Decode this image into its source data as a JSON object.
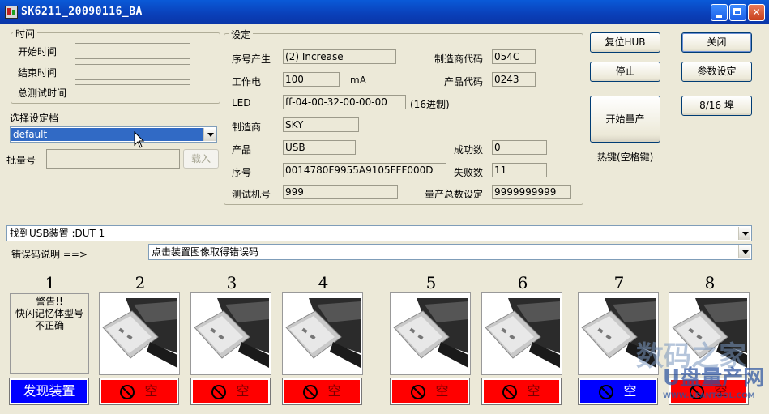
{
  "window": {
    "title": "SK6211_20090116_BA"
  },
  "time_group": {
    "legend": "时间",
    "start_label": "开始时间",
    "end_label": "结束时间",
    "total_label": "总测试时间",
    "start_value": "",
    "end_value": "",
    "total_value": ""
  },
  "profile": {
    "label": "选择设定档",
    "selected": "default"
  },
  "batch": {
    "label": "批量号",
    "value": "",
    "load_button": "载入"
  },
  "settings": {
    "legend": "设定",
    "serial_gen_label": "序号产生",
    "serial_gen_value": "(2) Increase",
    "current_label": "工作电",
    "current_value": "100",
    "current_unit": "mA",
    "led_label": "LED",
    "led_value": "ff-04-00-32-00-00-00",
    "led_note": "(16进制)",
    "vendor_label": "制造商",
    "vendor_value": "SKY",
    "product_label": "产品",
    "product_value": "USB",
    "serial_label": "序号",
    "serial_value": "0014780F9955A9105FFF000D",
    "tester_label": "测试机号",
    "tester_value": "999",
    "vendor_code_label": "制造商代码",
    "vendor_code_value": "054C",
    "product_code_label": "产品代码",
    "product_code_value": "0243",
    "success_label": "成功数",
    "success_value": "0",
    "fail_label": "失败数",
    "fail_value": "11",
    "total_label": "量产总数设定",
    "total_value": "9999999999"
  },
  "buttons": {
    "reset_hub": "复位HUB",
    "close": "关闭",
    "stop": "停止",
    "params": "参数设定",
    "ports": "8/16 埠",
    "start": "开始量产",
    "hotkey": "热键(空格键)"
  },
  "device_found": {
    "value": "找到USB装置 :DUT 1"
  },
  "error_desc": {
    "label": "错误码说明 ==>",
    "value": "点击装置图像取得错误码"
  },
  "slots": [
    {
      "num": "1",
      "warning": [
        "警告!!",
        "快闪记忆体型号",
        "不正确"
      ],
      "status": "发现装置",
      "color": "blue"
    },
    {
      "num": "2",
      "status": "空",
      "color": "red"
    },
    {
      "num": "3",
      "status": "空",
      "color": "red"
    },
    {
      "num": "4",
      "status": "空",
      "color": "red"
    },
    {
      "num": "5",
      "status": "空",
      "color": "red"
    },
    {
      "num": "6",
      "status": "空",
      "color": "red"
    },
    {
      "num": "7",
      "status": "空",
      "color": "blue"
    },
    {
      "num": "8",
      "status": "空",
      "color": "red"
    }
  ],
  "watermark": {
    "line1": "数码之家",
    "line2": "U盘量产网",
    "line3": "WWW.UPANTOOL.COM"
  },
  "colors": {
    "titlebar": "#0a4fd0",
    "status_red": "#ff0000",
    "status_blue": "#0000ff",
    "highlight": "#316ac5"
  }
}
